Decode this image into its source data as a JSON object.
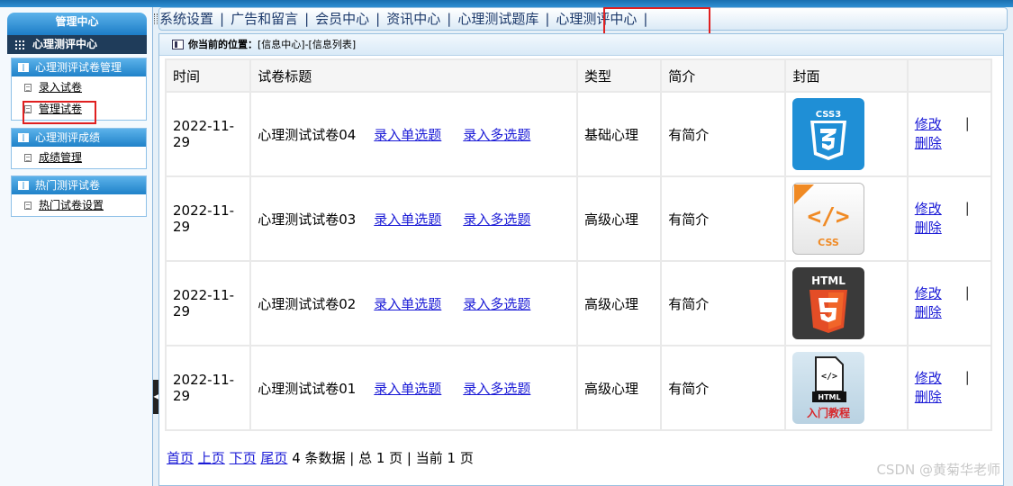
{
  "sidebar": {
    "header": "管理中心",
    "sub_header": "心理测评中心",
    "groups": [
      {
        "title": "心理测评试卷管理",
        "items": [
          "录入试卷",
          "管理试卷"
        ]
      },
      {
        "title": "心理测评成绩",
        "items": [
          "成绩管理"
        ]
      },
      {
        "title": "热门测评试卷",
        "items": [
          "热门试卷设置"
        ]
      }
    ]
  },
  "nav": {
    "items": [
      "系统设置",
      "广告和留言",
      "会员中心",
      "资讯中心",
      "心理测试题库",
      "心理测评中心"
    ],
    "separator": "|"
  },
  "breadcrumb": {
    "label": "你当前的位置：",
    "path": "[信息中心]-[信息列表]"
  },
  "table": {
    "headers": [
      "时间",
      "试卷标题",
      "类型",
      "简介",
      "封面",
      ""
    ],
    "link_single": "录入单选题",
    "link_multi": "录入多选题",
    "edit": "修改",
    "delete": "删除",
    "bar": "|",
    "rows": [
      {
        "date": "2022-11-29",
        "title": "心理测试试卷04",
        "type": "基础心理",
        "intro": "有简介",
        "cover": "CSS3"
      },
      {
        "date": "2022-11-29",
        "title": "心理测试试卷03",
        "type": "高级心理",
        "intro": "有简介",
        "cover": "CSS"
      },
      {
        "date": "2022-11-29",
        "title": "心理测试试卷02",
        "type": "高级心理",
        "intro": "有简介",
        "cover": "HTML"
      },
      {
        "date": "2022-11-29",
        "title": "心理测试试卷01",
        "type": "高级心理",
        "intro": "有简介",
        "cover": "入门教程"
      }
    ]
  },
  "pager": {
    "first": "首页",
    "prev": "上页",
    "next": "下页",
    "last": "尾页",
    "summary": "4 条数据 | 总 1 页 | 当前 1 页"
  },
  "watermark": "CSDN @黄菊华老师",
  "colors": {
    "accent": "#1c7dc7",
    "link": "#1a1ad6",
    "highlight": "#e02020"
  }
}
